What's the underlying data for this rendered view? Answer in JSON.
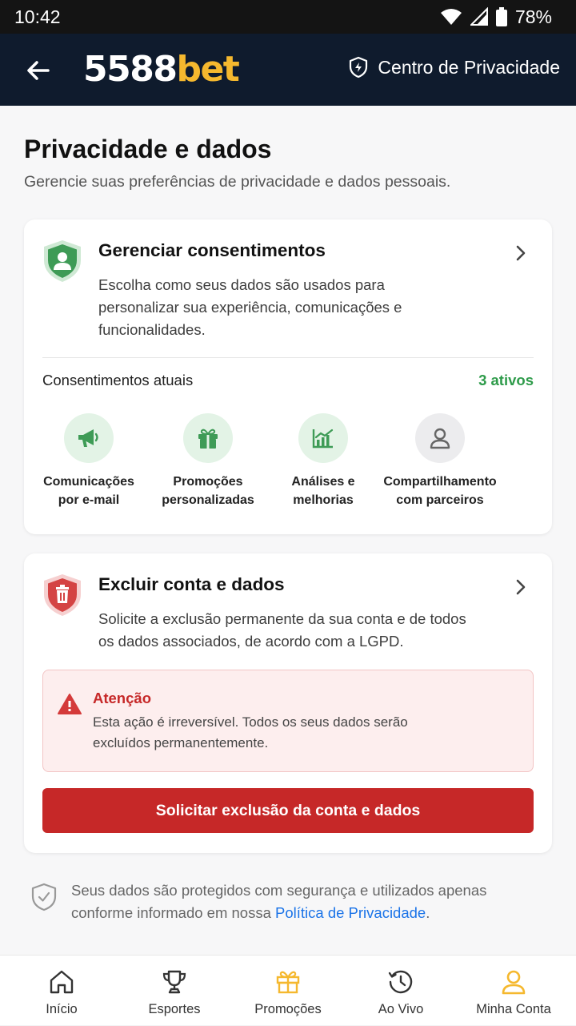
{
  "status": {
    "time": "10:42",
    "battery": "78%"
  },
  "header": {
    "logo_main": "5588",
    "logo_accent": "bet",
    "privacy_center": "Centro de Privacidade"
  },
  "page": {
    "title": "Privacidade e dados",
    "subtitle": "Gerencie suas preferências de privacidade e dados pessoais."
  },
  "consents_card": {
    "title": "Gerenciar consentimentos",
    "description": "Escolha como seus dados são usados para personalizar sua experiência, comunicações e funcionalidades.",
    "current_label": "Consentimentos atuais",
    "active_count": "3 ativos",
    "items": [
      {
        "line1": "Comunicações",
        "line2": "por e-mail",
        "icon": "megaphone-icon",
        "active": true
      },
      {
        "line1": "Promoções",
        "line2": "personalizadas",
        "icon": "gift-icon",
        "active": true
      },
      {
        "line1": "Análises e",
        "line2": "melhorias",
        "icon": "chart-icon",
        "active": true
      },
      {
        "line1": "Compartilhamento",
        "line2": "com parceiros",
        "icon": "user-icon",
        "active": false
      }
    ]
  },
  "delete_card": {
    "title": "Excluir conta e dados",
    "description": "Solicite a exclusão permanente da sua conta e de todos os dados associados, de acordo com a LGPD.",
    "warning_title": "Atenção",
    "warning_text": "Esta ação é irreversível. Todos os seus dados serão excluídos permanentemente.",
    "button_label": "Solicitar exclusão da conta e dados"
  },
  "footer": {
    "text": "Seus dados são protegidos com segurança e utilizados apenas conforme informado em nossa ",
    "link": "Política de Privacidade",
    "end": "."
  },
  "nav": {
    "items": [
      {
        "label": "Início",
        "icon": "home-icon"
      },
      {
        "label": "Esportes",
        "icon": "trophy-icon"
      },
      {
        "label": "Promoções",
        "icon": "gift-icon"
      },
      {
        "label": "Ao Vivo",
        "icon": "clock-icon"
      },
      {
        "label": "Minha Conta",
        "icon": "user-icon"
      }
    ]
  },
  "colors": {
    "header_bg": "#0f1b2d",
    "brand_accent": "#f5b82e",
    "success_green": "#2e9b4a",
    "danger_red": "#c62828",
    "link_blue": "#1a73e8"
  }
}
